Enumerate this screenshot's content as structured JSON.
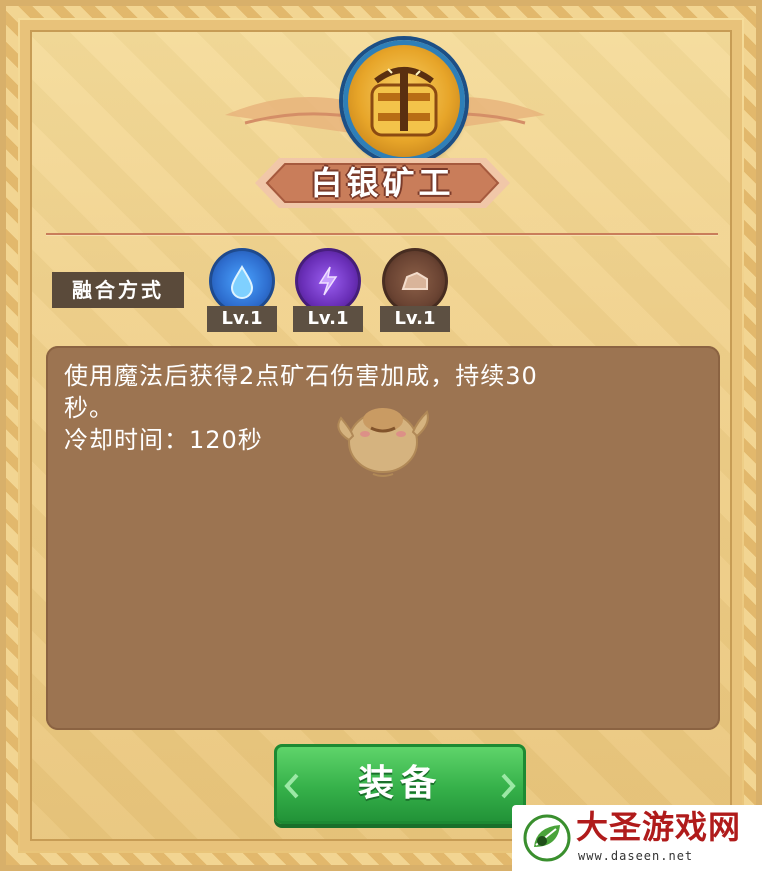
{
  "card": {
    "title": "白银矿工",
    "icon": "pickaxe-medal-icon"
  },
  "fusion": {
    "label": "融合方式",
    "elements": [
      {
        "icon": "water-drop-icon",
        "color": "#2f6fd0",
        "level": "Lv.1"
      },
      {
        "icon": "lightning-icon",
        "color": "#6a2fb8",
        "level": "Lv.1"
      },
      {
        "icon": "rock-icon",
        "color": "#6b4433",
        "level": "Lv.1"
      }
    ]
  },
  "description": {
    "line1": "使用魔法后获得2点矿石伤害加成，持续30",
    "line2": "秒。",
    "line3": "冷却时间：120秒"
  },
  "equip_button": {
    "label": "装备"
  },
  "watermark": {
    "name": "大圣游戏网",
    "url": "www.daseen.net"
  },
  "colors": {
    "panel": "#9c7451",
    "button": "#36b14a",
    "ribbon": "#c97d5a"
  }
}
